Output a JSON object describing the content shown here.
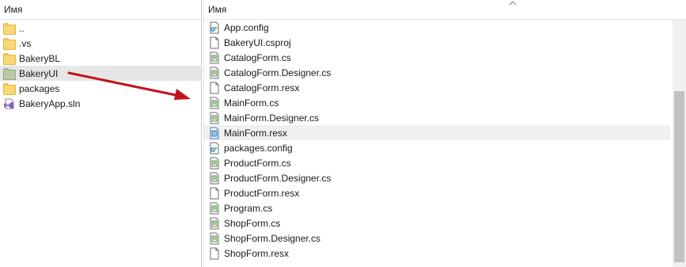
{
  "left_pane": {
    "column_header": "Имя",
    "items": [
      {
        "label": "..",
        "icon": "folder-icon"
      },
      {
        "label": ".vs",
        "icon": "folder-icon"
      },
      {
        "label": "BakeryBL",
        "icon": "folder-icon"
      },
      {
        "label": "BakeryUI",
        "icon": "folder-icon",
        "selected": true
      },
      {
        "label": "packages",
        "icon": "folder-icon"
      },
      {
        "label": "BakeryApp.sln",
        "icon": "visual-studio-solution-icon"
      }
    ]
  },
  "right_pane": {
    "column_header": "Имя",
    "items": [
      {
        "label": "App.config",
        "icon": "config-file-icon"
      },
      {
        "label": "BakeryUI.csproj",
        "icon": "blank-file-icon"
      },
      {
        "label": "CatalogForm.cs",
        "icon": "code-file-icon"
      },
      {
        "label": "CatalogForm.Designer.cs",
        "icon": "code-file-icon"
      },
      {
        "label": "CatalogForm.resx",
        "icon": "blank-file-icon"
      },
      {
        "label": "MainForm.cs",
        "icon": "code-file-icon"
      },
      {
        "label": "MainForm.Designer.cs",
        "icon": "code-file-icon"
      },
      {
        "label": "MainForm.resx",
        "icon": "resx-file-icon",
        "hover": true
      },
      {
        "label": "packages.config",
        "icon": "config-file-icon"
      },
      {
        "label": "ProductForm.cs",
        "icon": "code-file-icon"
      },
      {
        "label": "ProductForm.Designer.cs",
        "icon": "code-file-icon"
      },
      {
        "label": "ProductForm.resx",
        "icon": "blank-file-icon"
      },
      {
        "label": "Program.cs",
        "icon": "code-file-icon"
      },
      {
        "label": "ShopForm.cs",
        "icon": "code-file-icon"
      },
      {
        "label": "ShopForm.Designer.cs",
        "icon": "code-file-icon"
      },
      {
        "label": "ShopForm.resx",
        "icon": "blank-file-icon"
      }
    ]
  },
  "colors": {
    "arrow": "#c0141b",
    "folder": "#f8d775",
    "selected_folder": "#b8c9a4",
    "selected_row": "#e6e6e6"
  }
}
